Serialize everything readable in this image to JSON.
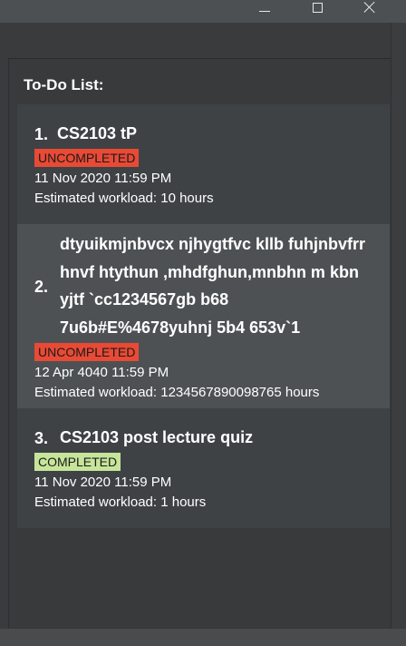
{
  "window": {
    "minimize_icon": "minimize-icon",
    "maximize_icon": "maximize-icon",
    "close_icon": "close-icon"
  },
  "list": {
    "title": "To-Do List:",
    "items": [
      {
        "index": "1.",
        "name": "CS2103 tP",
        "status": "UNCOMPLETED",
        "date": "11 Nov 2020 11:59 PM",
        "workload": "Estimated workload: 10 hours"
      },
      {
        "index": "2.",
        "name_lines": [
          "dtyuikmjnbvcx njhygtfvc kllb fuhjnbvfrr",
          "hnvf htythun ,mhdfghun,mnbhn m kbn",
          "yjtf `cc1234567gb b68",
          "7u6b#E%4678yuhnj 5b4 653v`1"
        ],
        "status": "UNCOMPLETED",
        "date": "12 Apr 4040 11:59 PM",
        "workload": "Estimated workload: 1234567890098765 hours"
      },
      {
        "index": "3.",
        "name": "CS2103 post lecture quiz",
        "status": "COMPLETED",
        "date": "11 Nov 2020 11:59 PM",
        "workload": "Estimated workload: 1 hours"
      }
    ]
  },
  "colors": {
    "uncompleted": "#e84a35",
    "completed": "#c6e59a",
    "card": "#3f4245",
    "card_selected": "#4d5154"
  }
}
